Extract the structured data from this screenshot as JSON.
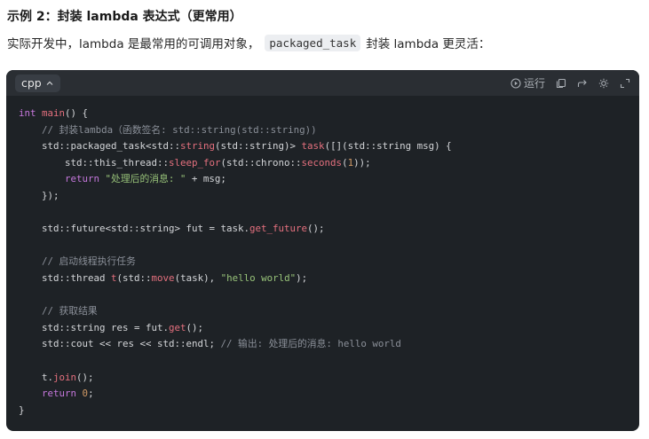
{
  "heading": "示例 2：封装 lambda 表达式（更常用）",
  "intro": {
    "before": "实际开发中，lambda 是最常用的可调用对象，",
    "code": "packaged_task",
    "after": "封装 lambda 更灵活："
  },
  "code_block": {
    "language": "cpp",
    "run_label": "运行",
    "icons": [
      "play-icon",
      "copy-icon",
      "share-icon",
      "theme-icon",
      "expand-icon"
    ],
    "lines": [
      [
        [
          "kw",
          "int"
        ],
        [
          "pl",
          " "
        ],
        [
          "fn",
          "main"
        ],
        [
          "pl",
          "() {"
        ]
      ],
      [
        [
          "cm",
          "    // 封装lambda（函数签名: std::string(std::string))"
        ]
      ],
      [
        [
          "pl",
          "    std::packaged_task<std::"
        ],
        [
          "fn",
          "string"
        ],
        [
          "pl",
          "(std::string)> "
        ],
        [
          "fn",
          "task"
        ],
        [
          "pl",
          "([](std::string msg) {"
        ]
      ],
      [
        [
          "pl",
          "        std::this_thread::"
        ],
        [
          "fn",
          "sleep_for"
        ],
        [
          "pl",
          "(std::chrono::"
        ],
        [
          "fn",
          "seconds"
        ],
        [
          "pl",
          "("
        ],
        [
          "num",
          "1"
        ],
        [
          "pl",
          "));"
        ]
      ],
      [
        [
          "pl",
          "        "
        ],
        [
          "kw",
          "return"
        ],
        [
          "pl",
          " "
        ],
        [
          "str",
          "\"处理后的消息: \""
        ],
        [
          "pl",
          " + msg;"
        ]
      ],
      [
        [
          "pl",
          "    });"
        ]
      ],
      [
        [
          "pl",
          ""
        ]
      ],
      [
        [
          "pl",
          "    std::future<std::string> fut = task."
        ],
        [
          "fn",
          "get_future"
        ],
        [
          "pl",
          "();"
        ]
      ],
      [
        [
          "pl",
          ""
        ]
      ],
      [
        [
          "cm",
          "    // 启动线程执行任务"
        ]
      ],
      [
        [
          "pl",
          "    std::thread "
        ],
        [
          "fn",
          "t"
        ],
        [
          "pl",
          "(std::"
        ],
        [
          "fn",
          "move"
        ],
        [
          "pl",
          "(task), "
        ],
        [
          "str",
          "\"hello world\""
        ],
        [
          "pl",
          ");"
        ]
      ],
      [
        [
          "pl",
          ""
        ]
      ],
      [
        [
          "cm",
          "    // 获取结果"
        ]
      ],
      [
        [
          "pl",
          "    std::string res = fut."
        ],
        [
          "fn",
          "get"
        ],
        [
          "pl",
          "();"
        ]
      ],
      [
        [
          "pl",
          "    std::cout << res << std::endl; "
        ],
        [
          "cm",
          "// 输出: 处理后的消息: hello world"
        ]
      ],
      [
        [
          "pl",
          ""
        ]
      ],
      [
        [
          "pl",
          "    t."
        ],
        [
          "fn",
          "join"
        ],
        [
          "pl",
          "();"
        ]
      ],
      [
        [
          "pl",
          "    "
        ],
        [
          "kw",
          "return"
        ],
        [
          "pl",
          " "
        ],
        [
          "num",
          "0"
        ],
        [
          "pl",
          ";"
        ]
      ],
      [
        [
          "pl",
          "}"
        ]
      ]
    ]
  }
}
